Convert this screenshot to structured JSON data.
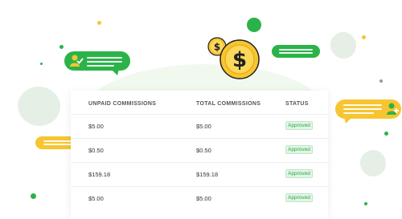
{
  "table": {
    "headers": [
      "UNPAID COMMISSIONS",
      "TOTAL COMMISSIONS",
      "STATUS"
    ],
    "rows": [
      {
        "unpaid": "$5.00",
        "total": "$5.00",
        "status": "Approved"
      },
      {
        "unpaid": "$0.50",
        "total": "$0.50",
        "status": "Approved"
      },
      {
        "unpaid": "$159.18",
        "total": "$159.18",
        "status": "Approved"
      },
      {
        "unpaid": "$5.00",
        "total": "$5.00",
        "status": "Approved"
      }
    ]
  },
  "icons": {
    "coin_large": "dollar-coin-icon",
    "coin_small": "dollar-coin-icon",
    "user_check": "user-check-icon",
    "user_add": "user-add-icon"
  },
  "colors": {
    "green": "#2bb34a",
    "yellow": "#f7c531",
    "approved_text": "#28a745",
    "approved_bg": "#e3f5e6"
  }
}
